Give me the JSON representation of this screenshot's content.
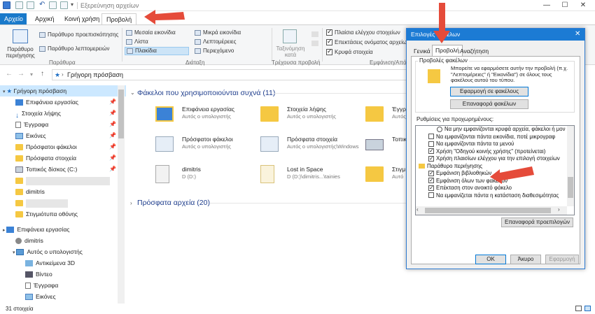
{
  "window": {
    "title": "Εξερεύνηση αρχείων"
  },
  "ribbon_tabs": [
    "Αρχείο",
    "Αρχική",
    "Κοινή χρήση",
    "Προβολή"
  ],
  "ribbon": {
    "pane_nav": "Παράθυρο περιήγησης",
    "preview_pane": "Παράθυρο προεπισκόπησης",
    "details_pane": "Παράθυρο λεπτομερειών",
    "group_panes": "Παράθυρα",
    "layout": [
      "Μεσαία εικονίδια",
      "Λίστα",
      "Πλακίδια",
      "Μικρά εικονίδια",
      "Λεπτομέρειες",
      "Περιεχόμενο"
    ],
    "group_layout": "Διάταξη",
    "sort": "Ταξινόμηση κατά",
    "group_current": "Τρέχουσα προβολή",
    "show_hide": [
      "Πλαίσια ελέγχου στοιχείων",
      "Επεκτάσεις ονόματος αρχείων",
      "Κρυφά στοιχεία"
    ],
    "group_show": "Εμφάνιση/Απόκρυψη"
  },
  "address": {
    "path": "Γρήγορη πρόσβαση"
  },
  "nav": {
    "quick": "Γρήγορη πρόσβαση",
    "items": [
      "Επιφάνεια εργασίας",
      "Στοιχεία λήψης",
      "Έγγραφα",
      "Εικόνες",
      "Πρόσφατοι φάκελοι",
      "Πρόσφατα στοιχεία",
      "Τοπικός δίσκος (C:)",
      "",
      "dimitris",
      "",
      "Στιγμιότυπα οθόνης"
    ],
    "desktop": "Επιφάνεια εργασίας",
    "user": "dimitris",
    "pc": "Αυτός ο υπολογιστής",
    "pc_items": [
      "Αντικείμενα 3D",
      "Βίντεο",
      "Έγγραφα",
      "Εικόνες"
    ]
  },
  "content": {
    "group1": "Φάκελοι που χρησιμοποιούνται συχνά (11)",
    "group2": "Πρόσφατα αρχεία (20)",
    "tiles": [
      {
        "name": "Επιφάνεια εργασίας",
        "sub": "Αυτός ο υπολογιστής"
      },
      {
        "name": "Στοιχεία λήψης",
        "sub": "Αυτός ο υπολογιστής"
      },
      {
        "name": "Έγγρα",
        "sub": "Αυτός"
      },
      {
        "name": "Πρόσφατοι φάκελοι",
        "sub": "Αυτός ο υπολογιστής"
      },
      {
        "name": "Πρόσφατα στοιχεία",
        "sub": "Αυτός ο υπολογιστής\\Windows"
      },
      {
        "name": "Τοπικ",
        "sub": ""
      },
      {
        "name": "dimitris",
        "sub": "D (D:)"
      },
      {
        "name": "Lost in Space",
        "sub": "D (D:)\\dimitris...\\tainies"
      },
      {
        "name": "Στιγμ",
        "sub": "Αυτό"
      }
    ]
  },
  "status": {
    "count": "31 στοιχεία"
  },
  "dialog": {
    "title": "Επιλογές φακέλων",
    "tabs": [
      "Γενικά",
      "Προβολή",
      "Αναζήτηση"
    ],
    "fsg_title": "Προβολές φακέλων",
    "fsg_desc": "Μπορείτε να εφαρμόσετε αυτήν την προβολή (π.χ. \"Λεπτομέρειες\" ή \"Εικονίδια\") σε όλους τους φακέλους αυτού του τύπου.",
    "apply_btn": "Εφαρμογή σε φακέλους",
    "reset_btn": "Επαναφορά φακέλων",
    "adv_title": "Ρυθμίσεις για προχωρημένους:",
    "list": [
      "Να μην εμφανίζονται κρυφά αρχεία, φάκελοι ή μον",
      "Να εμφανίζονται πάντα εικονίδια, ποτέ μικρογραφ",
      "Να εμφανίζονται πάντα τα μενού",
      "Χρήση \"Οδηγού κοινής χρήσης\" (προτείνεται)",
      "Χρήση πλαισίων ελέγχου για την επιλογή στοιχείων",
      "Παράθυρο περιήγησης",
      "Εμφάνιση βιβλιοθηκών",
      "Εμφάνιση όλων των φακέλων",
      "Επέκταση στον ανοικτό φάκελο",
      "Να εμφανίζεται πάντα η κατάσταση διαθεσιμότητας"
    ],
    "restore_btn": "Επαναφορά προεπιλογών",
    "ok": "OK",
    "cancel": "Άκυρο",
    "apply": "Εφαρμογή"
  }
}
